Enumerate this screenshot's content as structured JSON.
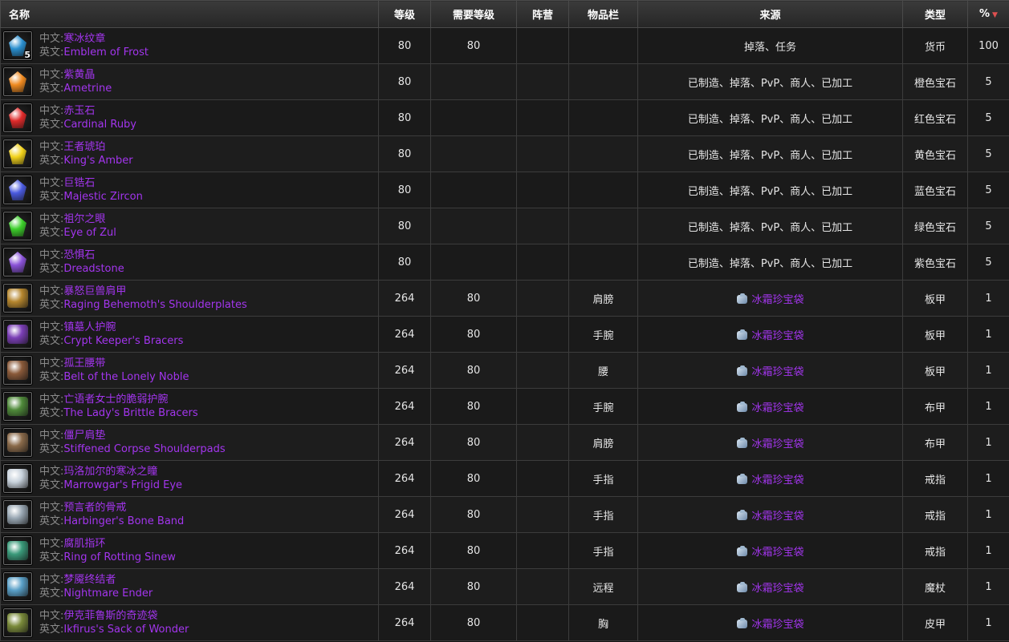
{
  "header": {
    "name": "名称",
    "level": "等级",
    "req_level": "需要等级",
    "faction": "阵营",
    "slot": "物品栏",
    "source": "来源",
    "type": "类型",
    "percent": "%"
  },
  "labels": {
    "cn": "中文:",
    "en": "英文:"
  },
  "items": [
    {
      "icon": "emblem-of-frost-icon",
      "icon_color": "#2a8fcf",
      "stack": "5",
      "cn": "寒冰纹章",
      "en": "Emblem of Frost",
      "level": "80",
      "req": "80",
      "faction": "",
      "slot": "",
      "source": "掉落、任务",
      "source_link": false,
      "type": "货币",
      "pct": "100"
    },
    {
      "icon": "ametrine-icon",
      "icon_color": "#f08a20",
      "stack": "",
      "cn": "紫黄晶",
      "en": "Ametrine",
      "level": "80",
      "req": "",
      "faction": "",
      "slot": "",
      "source": "已制造、掉落、PvP、商人、已加工",
      "source_link": false,
      "type": "橙色宝石",
      "pct": "5"
    },
    {
      "icon": "cardinal-ruby-icon",
      "icon_color": "#e02a2a",
      "stack": "",
      "cn": "赤玉石",
      "en": "Cardinal Ruby",
      "level": "80",
      "req": "",
      "faction": "",
      "slot": "",
      "source": "已制造、掉落、PvP、商人、已加工",
      "source_link": false,
      "type": "红色宝石",
      "pct": "5"
    },
    {
      "icon": "kings-amber-icon",
      "icon_color": "#f2d21a",
      "stack": "",
      "cn": "王者琥珀",
      "en": "King's Amber",
      "level": "80",
      "req": "",
      "faction": "",
      "slot": "",
      "source": "已制造、掉落、PvP、商人、已加工",
      "source_link": false,
      "type": "黄色宝石",
      "pct": "5"
    },
    {
      "icon": "majestic-zircon-icon",
      "icon_color": "#4a5adf",
      "stack": "",
      "cn": "巨锆石",
      "en": "Majestic Zircon",
      "level": "80",
      "req": "",
      "faction": "",
      "slot": "",
      "source": "已制造、掉落、PvP、商人、已加工",
      "source_link": false,
      "type": "蓝色宝石",
      "pct": "5"
    },
    {
      "icon": "eye-of-zul-icon",
      "icon_color": "#3ccf2a",
      "stack": "",
      "cn": "祖尔之眼",
      "en": "Eye of Zul",
      "level": "80",
      "req": "",
      "faction": "",
      "slot": "",
      "source": "已制造、掉落、PvP、商人、已加工",
      "source_link": false,
      "type": "绿色宝石",
      "pct": "5"
    },
    {
      "icon": "dreadstone-icon",
      "icon_color": "#8a52d8",
      "stack": "",
      "cn": "恐惧石",
      "en": "Dreadstone",
      "level": "80",
      "req": "",
      "faction": "",
      "slot": "",
      "source": "已制造、掉落、PvP、商人、已加工",
      "source_link": false,
      "type": "紫色宝石",
      "pct": "5"
    },
    {
      "icon": "shoulderplates-icon",
      "icon_color": "#b5862e",
      "stack": "",
      "cn": "暴怒巨兽肩甲",
      "en": "Raging Behemoth's Shoulderplates",
      "level": "264",
      "req": "80",
      "faction": "",
      "slot": "肩膀",
      "source": "冰霜珍宝袋",
      "source_link": true,
      "type": "板甲",
      "pct": "1"
    },
    {
      "icon": "bracers-icon",
      "icon_color": "#7b3fb6",
      "stack": "",
      "cn": "镇墓人护腕",
      "en": "Crypt Keeper's Bracers",
      "level": "264",
      "req": "80",
      "faction": "",
      "slot": "手腕",
      "source": "冰霜珍宝袋",
      "source_link": true,
      "type": "板甲",
      "pct": "1"
    },
    {
      "icon": "belt-icon",
      "icon_color": "#8a5a3a",
      "stack": "",
      "cn": "孤王腰带",
      "en": "Belt of the Lonely Noble",
      "level": "264",
      "req": "80",
      "faction": "",
      "slot": "腰",
      "source": "冰霜珍宝袋",
      "source_link": true,
      "type": "板甲",
      "pct": "1"
    },
    {
      "icon": "cloth-bracers-icon",
      "icon_color": "#4f8a3a",
      "stack": "",
      "cn": "亡语者女士的脆弱护腕",
      "en": "The Lady's Brittle Bracers",
      "level": "264",
      "req": "80",
      "faction": "",
      "slot": "手腕",
      "source": "冰霜珍宝袋",
      "source_link": true,
      "type": "布甲",
      "pct": "1"
    },
    {
      "icon": "shoulderpads-icon",
      "icon_color": "#8a6a4a",
      "stack": "",
      "cn": "僵尸肩垫",
      "en": "Stiffened Corpse Shoulderpads",
      "level": "264",
      "req": "80",
      "faction": "",
      "slot": "肩膀",
      "source": "冰霜珍宝袋",
      "source_link": true,
      "type": "布甲",
      "pct": "1"
    },
    {
      "icon": "frigid-eye-icon",
      "icon_color": "#c8d2dc",
      "stack": "",
      "cn": "玛洛加尔的寒冰之瞳",
      "en": "Marrowgar's Frigid Eye",
      "level": "264",
      "req": "80",
      "faction": "",
      "slot": "手指",
      "source": "冰霜珍宝袋",
      "source_link": true,
      "type": "戒指",
      "pct": "1"
    },
    {
      "icon": "bone-band-icon",
      "icon_color": "#9aa8b4",
      "stack": "",
      "cn": "预言者的骨戒",
      "en": "Harbinger's Bone Band",
      "level": "264",
      "req": "80",
      "faction": "",
      "slot": "手指",
      "source": "冰霜珍宝袋",
      "source_link": true,
      "type": "戒指",
      "pct": "1"
    },
    {
      "icon": "rotting-sinew-icon",
      "icon_color": "#3a9a7a",
      "stack": "",
      "cn": "腐肌指环",
      "en": "Ring of Rotting Sinew",
      "level": "264",
      "req": "80",
      "faction": "",
      "slot": "手指",
      "source": "冰霜珍宝袋",
      "source_link": true,
      "type": "戒指",
      "pct": "1"
    },
    {
      "icon": "wand-icon",
      "icon_color": "#5aa0c8",
      "stack": "",
      "cn": "梦魇终结者",
      "en": "Nightmare Ender",
      "level": "264",
      "req": "80",
      "faction": "",
      "slot": "远程",
      "source": "冰霜珍宝袋",
      "source_link": true,
      "type": "魔杖",
      "pct": "1"
    },
    {
      "icon": "sack-of-wonder-icon",
      "icon_color": "#7a8a3a",
      "stack": "",
      "cn": "伊克菲鲁斯的奇迹袋",
      "en": "Ikfirus's Sack of Wonder",
      "level": "264",
      "req": "80",
      "faction": "",
      "slot": "胸",
      "source": "冰霜珍宝袋",
      "source_link": true,
      "type": "皮甲",
      "pct": "1"
    }
  ]
}
